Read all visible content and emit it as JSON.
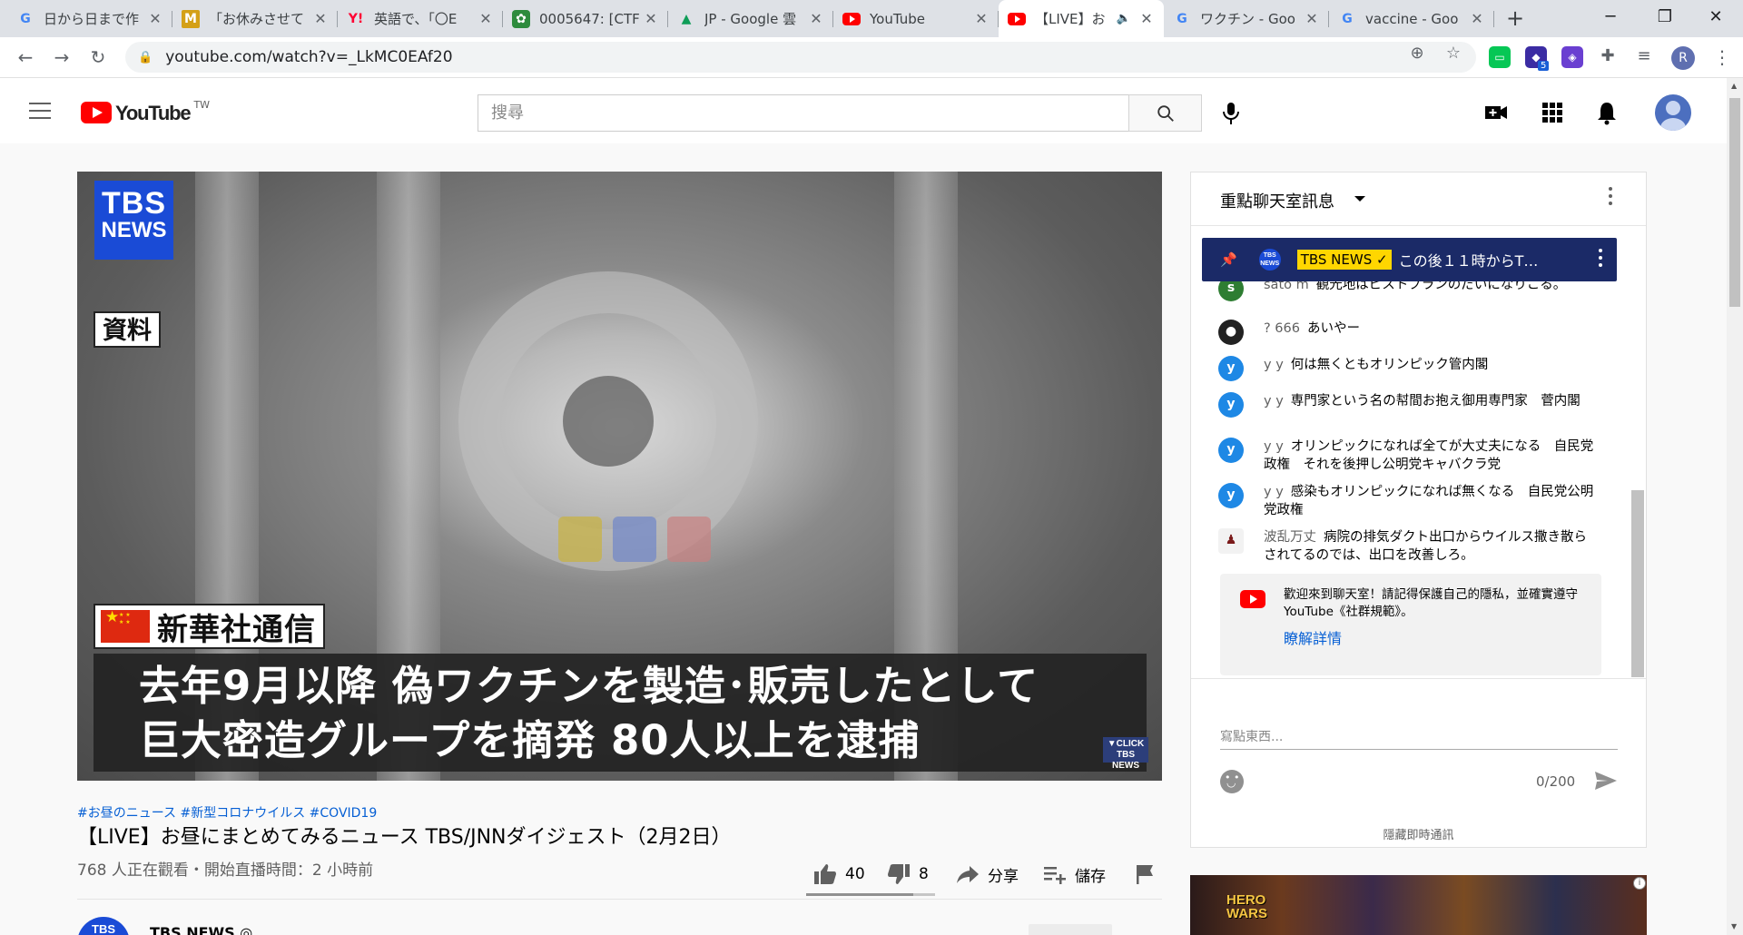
{
  "browser": {
    "tabs": [
      {
        "title": "日から日まで作",
        "favicon": "google-icon"
      },
      {
        "title": "「お休みさせて",
        "favicon": "m-icon"
      },
      {
        "title": "英語で、「〇E",
        "favicon": "yahoo-icon"
      },
      {
        "title": "0005647: [CTF",
        "favicon": "mantis-icon"
      },
      {
        "title": "JP - Google 雲",
        "favicon": "drive-icon"
      },
      {
        "title": "YouTube",
        "favicon": "youtube-icon"
      },
      {
        "title": "【LIVE】お",
        "favicon": "youtube-icon",
        "active": true
      },
      {
        "title": "ワクチン - Goo",
        "favicon": "google-icon"
      },
      {
        "title": "vaccine - Goo",
        "favicon": "google-icon"
      }
    ],
    "url": "youtube.com/watch?v=_LkMC0EAf20",
    "profile_initial": "R",
    "extension_badge": "5"
  },
  "masthead": {
    "logo_text": "YouTube",
    "region": "TW",
    "search_placeholder": "搜尋"
  },
  "video": {
    "overlay": {
      "logo_line1": "TBS",
      "logo_line2": "NEWS",
      "label": "資料",
      "source": "新華社通信",
      "caption_line1": "去年9月以降 偽ワクチンを製造･販売したとして",
      "caption_line2": "巨大密造グループを摘発 80人以上を逮捕",
      "badge_line1": "▼CLICK",
      "badge_line2": "TBS NEWS"
    },
    "hashtags": "#お昼のニュース #新型コロナウイルス #COVID19",
    "title": "【LIVE】お昼にまとめてみるニュース TBS/JNNダイジェスト（2月2日）",
    "meta": "768 人正在觀看・開始直播時間：2 小時前",
    "likes": "40",
    "dislikes": "8",
    "like_ratio": 0.83,
    "share_label": "分享",
    "save_label": "儲存",
    "channel_name": "TBS NEWS ◎",
    "channel_avatar": "TBS"
  },
  "chat": {
    "header": "重點聊天室訊息",
    "pinned": {
      "badge": "TBS NEWS ✓",
      "text": "この後１１時からT…",
      "avatar": "TBS NEWS"
    },
    "messages": [
      {
        "avatar": "s",
        "author": "sato m",
        "text": "観光地はビストプランのだいになりこる。",
        "avatar_color": "#2e7d32"
      },
      {
        "avatar": "",
        "author": "? 666",
        "text": "あいやー",
        "avatar_color": "#222222"
      },
      {
        "avatar": "y",
        "author": "y y",
        "text": "何は無くともオリンピック管内閣",
        "avatar_color": "#1e88e5"
      },
      {
        "avatar": "y",
        "author": "y y",
        "text": "専門家という名の幇間お抱え御用専門家　菅内閣",
        "avatar_color": "#1e88e5"
      },
      {
        "avatar": "y",
        "author": "y y",
        "text": "オリンピックになれば全てが大丈夫になる　自民党政権　それを後押し公明党キャバクラ党",
        "avatar_color": "#1e88e5"
      },
      {
        "avatar": "y",
        "author": "y y",
        "text": "感染もオリンピックになれば無くなる　自民党公明党政権",
        "avatar_color": "#1e88e5"
      },
      {
        "avatar": "",
        "author": "波乱万丈",
        "text": "病院の排気ダクト出口からウイルス撒き散らされてるのでは、出口を改善しろ。",
        "avatar_color": "#7a1a1a"
      }
    ],
    "welcome": {
      "text": "歡迎來到聊天室！請記得保護自己的隱私，並確實遵守 YouTube《社群規範》。",
      "link": "瞭解詳情"
    },
    "input_placeholder": "寫點東西...",
    "counter": "0/200",
    "hide_label": "隱藏即時通訊"
  },
  "ad": {
    "logo_line1": "HERO",
    "logo_line2": "WARS",
    "info": "i"
  },
  "colors": {
    "youtube_red": "#ff0000",
    "link_blue": "#065fd4",
    "pinned_bg": "#1b2a67",
    "tbs_blue": "#1a4bd6"
  }
}
